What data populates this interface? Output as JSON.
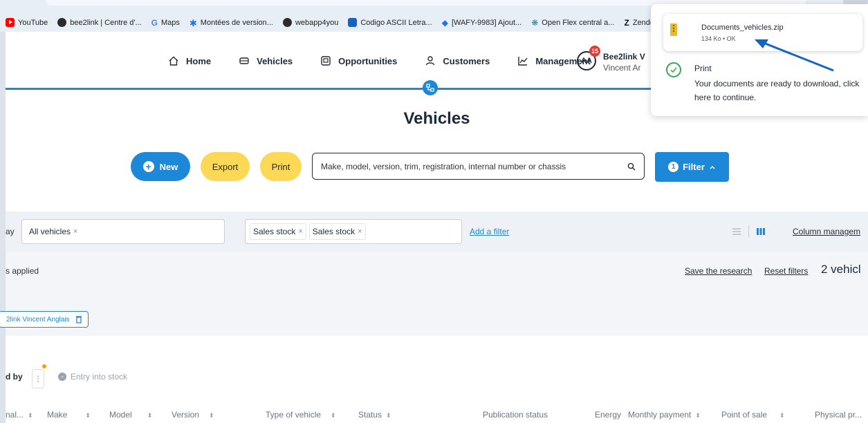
{
  "bookmarks": [
    {
      "label": "YouTube",
      "icon": "youtube-icon"
    },
    {
      "label": "bee2link | Centre d'...",
      "icon": "site-icon"
    },
    {
      "label": "Maps",
      "icon": "google-icon"
    },
    {
      "label": "Montées de version...",
      "icon": "star-icon"
    },
    {
      "label": "webapp4you",
      "icon": "site-icon"
    },
    {
      "label": "Codigo ASCII Letra...",
      "icon": "square-icon"
    },
    {
      "label": "[WAFY-9983] Ajout...",
      "icon": "diamond-icon"
    },
    {
      "label": "Open Flex central a...",
      "icon": "flex-icon"
    },
    {
      "label": "Zende",
      "icon": "zendesk-icon"
    }
  ],
  "nav": {
    "items": [
      {
        "label": "Home",
        "icon": "home-icon"
      },
      {
        "label": "Vehicles",
        "icon": "car-icon"
      },
      {
        "label": "Opportunities",
        "icon": "opportunities-icon"
      },
      {
        "label": "Customers",
        "icon": "user-icon"
      },
      {
        "label": "Management",
        "icon": "chart-icon"
      }
    ],
    "user": {
      "initials": "AA",
      "notifications": "15",
      "org": "Bee2link V",
      "name": "Vincent Ar"
    }
  },
  "page_title": "Vehicles",
  "actions": {
    "new_label": "New",
    "export_label": "Export",
    "print_label": "Print",
    "search_placeholder": "Make, model, version, trim, registration, internal number or chassis",
    "filter_label": "Filter",
    "filter_count": "1"
  },
  "filter_bar": {
    "label": "ay",
    "display_chip": "All vehicles",
    "stock_chips": [
      "Sales stock",
      "Sales stock"
    ],
    "add_filter": "Add a filter",
    "column_management": "Column managem"
  },
  "filters_area": {
    "applied": "s applied",
    "save_research": "Save the research",
    "reset": "Reset filters",
    "count": "2 vehicl",
    "user_chip": "2link Vincent Anglais"
  },
  "sort": {
    "label": "d by",
    "entry": "Entry into stock"
  },
  "columns": [
    "nal...",
    "Make",
    "Model",
    "Version",
    "Type of vehicle",
    "Status",
    "Publication status",
    "Energy",
    "Monthly payment",
    "Point of sale",
    "Physical pr..."
  ],
  "download": {
    "file_name": "Documents_vehicles.zip",
    "file_meta": "134 Ko • OK",
    "print_title": "Print",
    "print_message": "Your documents are ready to download, click here to continue."
  },
  "colors": {
    "accent": "#1e88d8",
    "yellow": "#fbd956",
    "arrow": "#1565c0",
    "success": "#34a853"
  }
}
